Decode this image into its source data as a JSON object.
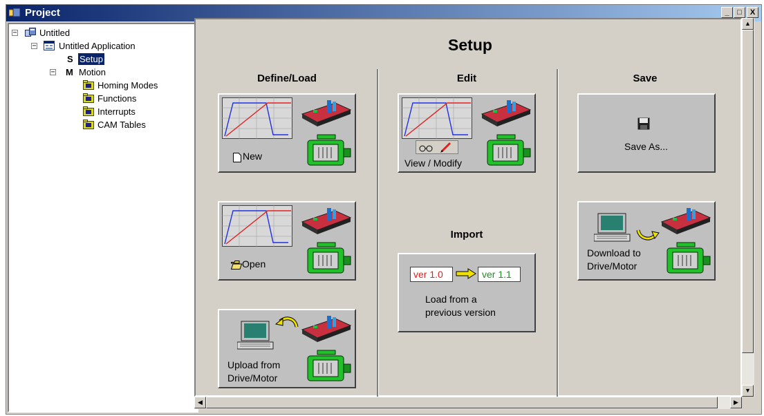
{
  "window": {
    "title": "Project",
    "buttons": {
      "minimize": "_",
      "maximize": "□",
      "close": "X"
    }
  },
  "tree": {
    "root": {
      "label": "Untitled",
      "toggle": "⊟"
    },
    "application": {
      "label": "Untitled Application",
      "toggle": "⊟"
    },
    "setup": {
      "letter": "S",
      "label": "Setup"
    },
    "motion": {
      "letter": "M",
      "label": "Motion",
      "toggle": "⊟"
    },
    "children": [
      "Homing Modes",
      "Functions",
      "Interrupts",
      "CAM Tables"
    ]
  },
  "main": {
    "title": "Setup",
    "columns": {
      "define_load": "Define/Load",
      "edit": "Edit",
      "save": "Save",
      "import": "Import"
    },
    "cards": {
      "new": "New",
      "open": "Open",
      "upload_line1": "Upload from",
      "upload_line2": "Drive/Motor",
      "view_modify": "View / Modify",
      "save_as": "Save As...",
      "download_line1": "Download to",
      "download_line2": "Drive/Motor",
      "import_old_ver": "ver 1.0",
      "import_new_ver": "ver 1.1",
      "import_line1": "Load from a",
      "import_line2": "previous version"
    }
  },
  "colors": {
    "titlebar_start": "#0a246a",
    "titlebar_end": "#a6caf0",
    "selection": "#0a246a",
    "motor_green": "#22c02a",
    "curve_red": "#e02020",
    "curve_blue": "#2030e0"
  }
}
